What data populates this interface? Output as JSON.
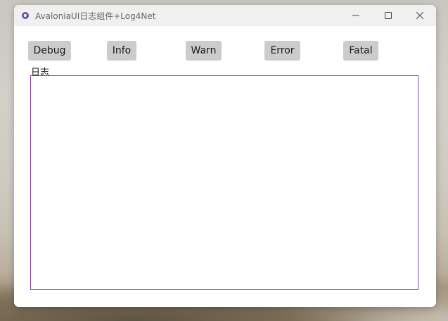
{
  "window": {
    "title": "AvaloniaUI日志组件+Log4Net",
    "app_icon": "avalonia-logo-icon",
    "caption_icons": [
      "minimize-icon",
      "maximize-icon",
      "close-icon"
    ]
  },
  "toolbar": {
    "buttons": [
      {
        "label": "Debug"
      },
      {
        "label": "Info"
      },
      {
        "label": "Warn"
      },
      {
        "label": "Error"
      },
      {
        "label": "Fatal"
      }
    ]
  },
  "log": {
    "label": "日志",
    "content": ""
  },
  "colors": {
    "accent_border": "#8a3bb0",
    "button_bg": "#cccccc",
    "titlebar_bg": "#f0f0f0"
  }
}
